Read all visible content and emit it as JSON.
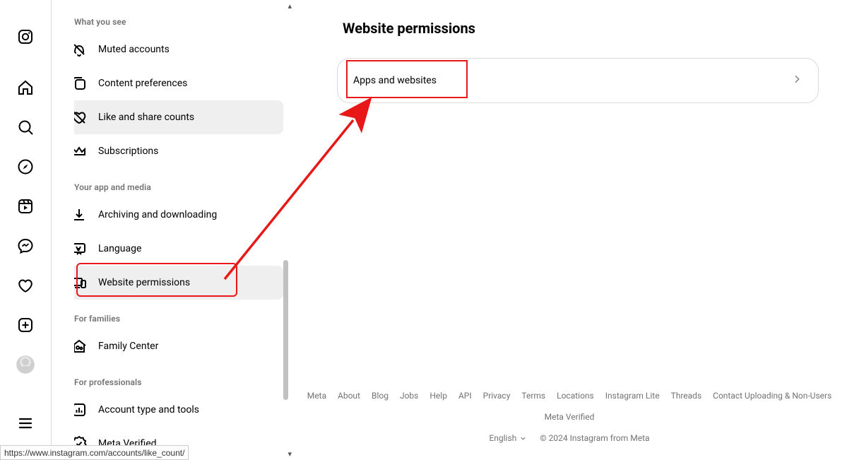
{
  "page": {
    "title": "Website permissions"
  },
  "card": {
    "row0": "Apps and websites"
  },
  "sidebar": {
    "sections": {
      "what_you_see": "What you see",
      "your_app_media": "Your app and media",
      "for_families": "For families",
      "for_professionals": "For professionals"
    },
    "items": {
      "muted_accounts": "Muted accounts",
      "content_preferences": "Content preferences",
      "like_share_counts": "Like and share counts",
      "subscriptions": "Subscriptions",
      "archiving_downloading": "Archiving and downloading",
      "language": "Language",
      "website_permissions": "Website permissions",
      "family_center": "Family Center",
      "account_type_tools": "Account type and tools",
      "meta_verified": "Meta Verified"
    }
  },
  "footer": {
    "links": {
      "meta": "Meta",
      "about": "About",
      "blog": "Blog",
      "jobs": "Jobs",
      "help": "Help",
      "api": "API",
      "privacy": "Privacy",
      "terms": "Terms",
      "locations": "Locations",
      "instagram_lite": "Instagram Lite",
      "threads": "Threads",
      "contact_upload": "Contact Uploading & Non-Users",
      "meta_verified": "Meta Verified"
    },
    "language": "English",
    "copyright": "© 2024 Instagram from Meta"
  },
  "status_bar": {
    "url": "https://www.instagram.com/accounts/like_count/"
  },
  "annotation": {
    "arrow_color": "#e81818"
  }
}
